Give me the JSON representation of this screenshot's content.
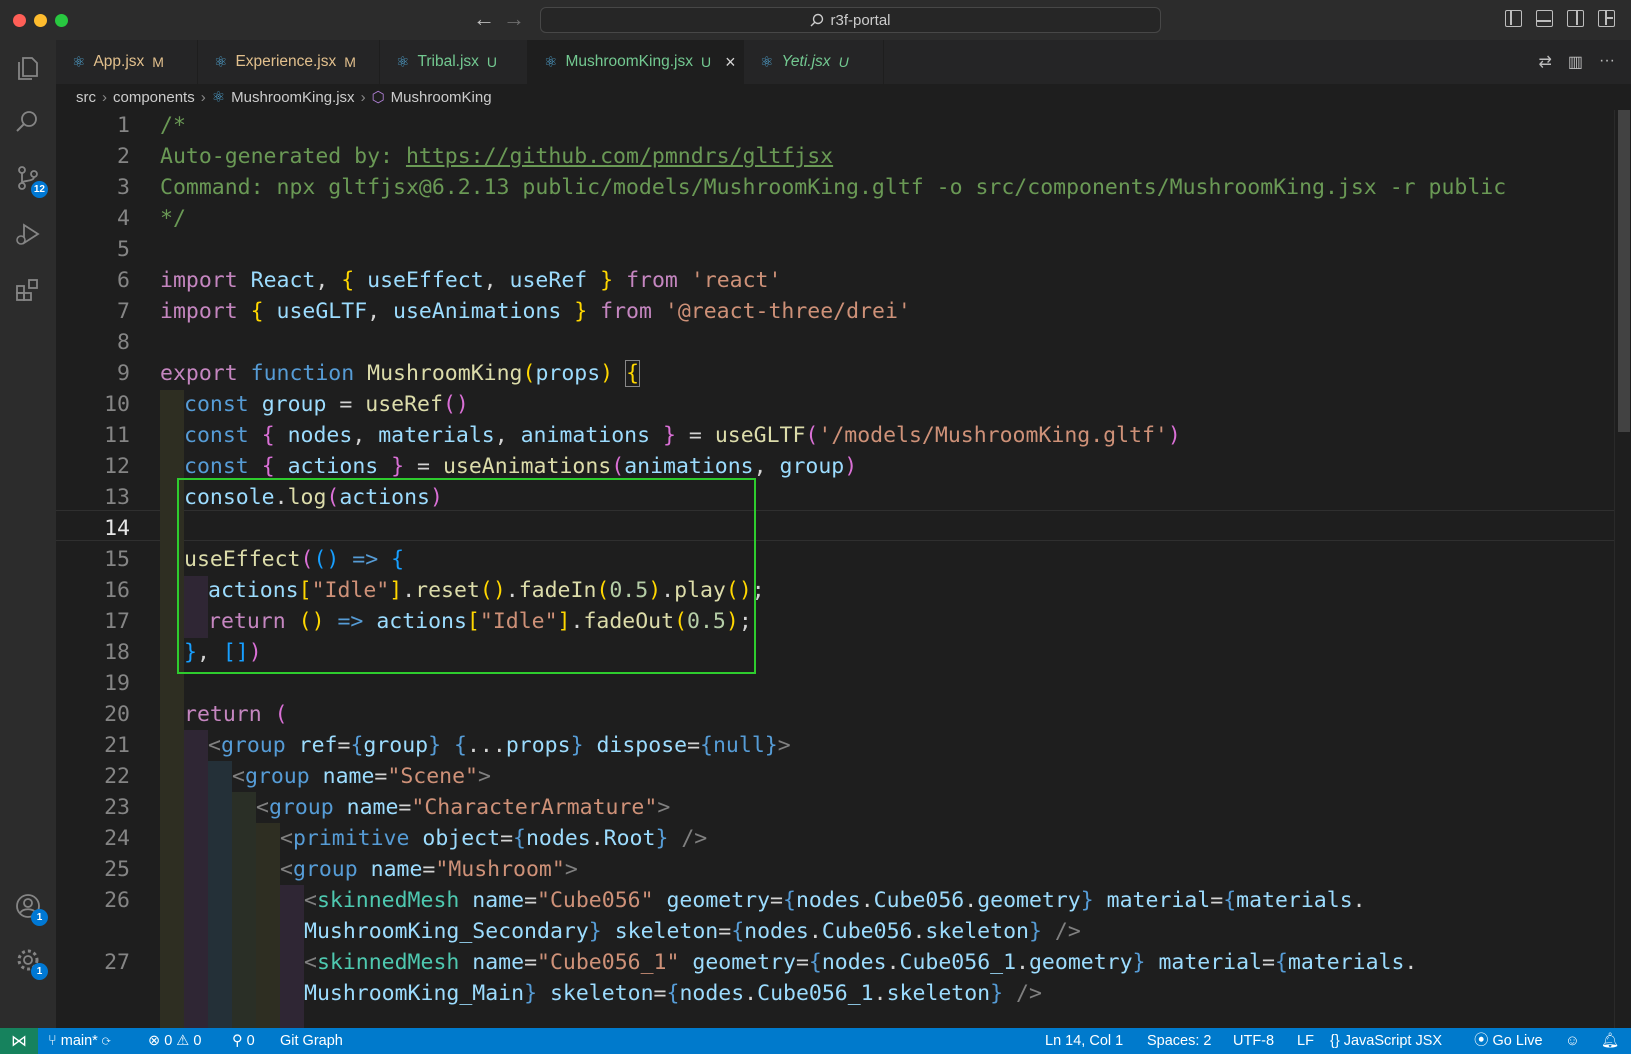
{
  "window": {
    "search_text": "r3f-portal"
  },
  "activity_bar": {
    "scm_badge": "12",
    "accounts_badge": "1",
    "settings_badge": "1"
  },
  "tabs": [
    {
      "name": "App.jsx",
      "status": "M"
    },
    {
      "name": "Experience.jsx",
      "status": "M"
    },
    {
      "name": "Tribal.jsx",
      "status": "U"
    },
    {
      "name": "MushroomKing.jsx",
      "status": "U",
      "active": true
    },
    {
      "name": "Yeti.jsx",
      "status": "U",
      "preview": true
    }
  ],
  "breadcrumb": [
    "src",
    "components",
    "MushroomKing.jsx",
    "MushroomKing"
  ],
  "line_numbers": [
    "1",
    "2",
    "3",
    "4",
    "5",
    "6",
    "7",
    "8",
    "9",
    "10",
    "11",
    "12",
    "13",
    "14",
    "15",
    "16",
    "17",
    "18",
    "19",
    "20",
    "21",
    "22",
    "23",
    "24",
    "25",
    "26",
    "27"
  ],
  "code": {
    "l1": "/*",
    "l2_prefix": "Auto-generated by: ",
    "l2_link": "https://github.com/pmndrs/gltfjsx",
    "l3": "Command: npx gltfjsx@6.2.13 public/models/MushroomKing.gltf -o src/components/MushroomKing.jsx -r public",
    "l4": "*/",
    "import": "import",
    "from": "from",
    "react_id": "React",
    "useEffect": "useEffect",
    "useRef": "useRef",
    "str_react": "'react'",
    "useGLTF": "useGLTF",
    "useAnimations": "useAnimations",
    "str_drei": "'@react-three/drei'",
    "export": "export",
    "function": "function",
    "comp_name": "MushroomKing",
    "props": "props",
    "const": "const",
    "group": "group",
    "nodes": "nodes",
    "materials": "materials",
    "animations": "animations",
    "actions": "actions",
    "str_model": "'/models/MushroomKing.gltf'",
    "console": "console",
    "log": "log",
    "str_idle": "\"Idle\"",
    "reset": "reset",
    "fadeIn": "fadeIn",
    "play": "play",
    "fadeOut": "fadeOut",
    "num_half": "0.5",
    "return": "return",
    "tag_group": "group",
    "tag_primitive": "primitive",
    "tag_skinned": "skinnedMesh",
    "attr_ref": "ref",
    "attr_dispose": "dispose",
    "null_kw": "null",
    "attr_name": "name",
    "attr_object": "object",
    "attr_geometry": "geometry",
    "attr_material": "material",
    "attr_skeleton": "skeleton",
    "str_scene": "\"Scene\"",
    "str_armature": "\"CharacterArmature\"",
    "root": "Root",
    "str_mushroom": "\"Mushroom\"",
    "str_cube056": "\"Cube056\"",
    "cube056": "Cube056",
    "cube056_1": "Cube056_1",
    "str_cube056_1": "\"Cube056_1\"",
    "geometry_prop": "geometry",
    "skeleton_prop": "skeleton",
    "mat_secondary": "MushroomKing_Secondary",
    "mat_main": "MushroomKing_Main"
  },
  "status_bar": {
    "branch": "main*",
    "errors": "0",
    "warnings": "0",
    "ports": "0",
    "git_graph": "Git Graph",
    "cursor": "Ln 14, Col 1",
    "spaces": "Spaces: 2",
    "encoding": "UTF-8",
    "eol": "LF",
    "language": "JavaScript JSX",
    "go_live": "Go Live"
  },
  "colors": {
    "editor_bg": "#1e1e1e",
    "status_bar": "#007acc",
    "highlight_box": "#2ecc2e",
    "modified": "#e2c08d",
    "untracked": "#73c991"
  }
}
